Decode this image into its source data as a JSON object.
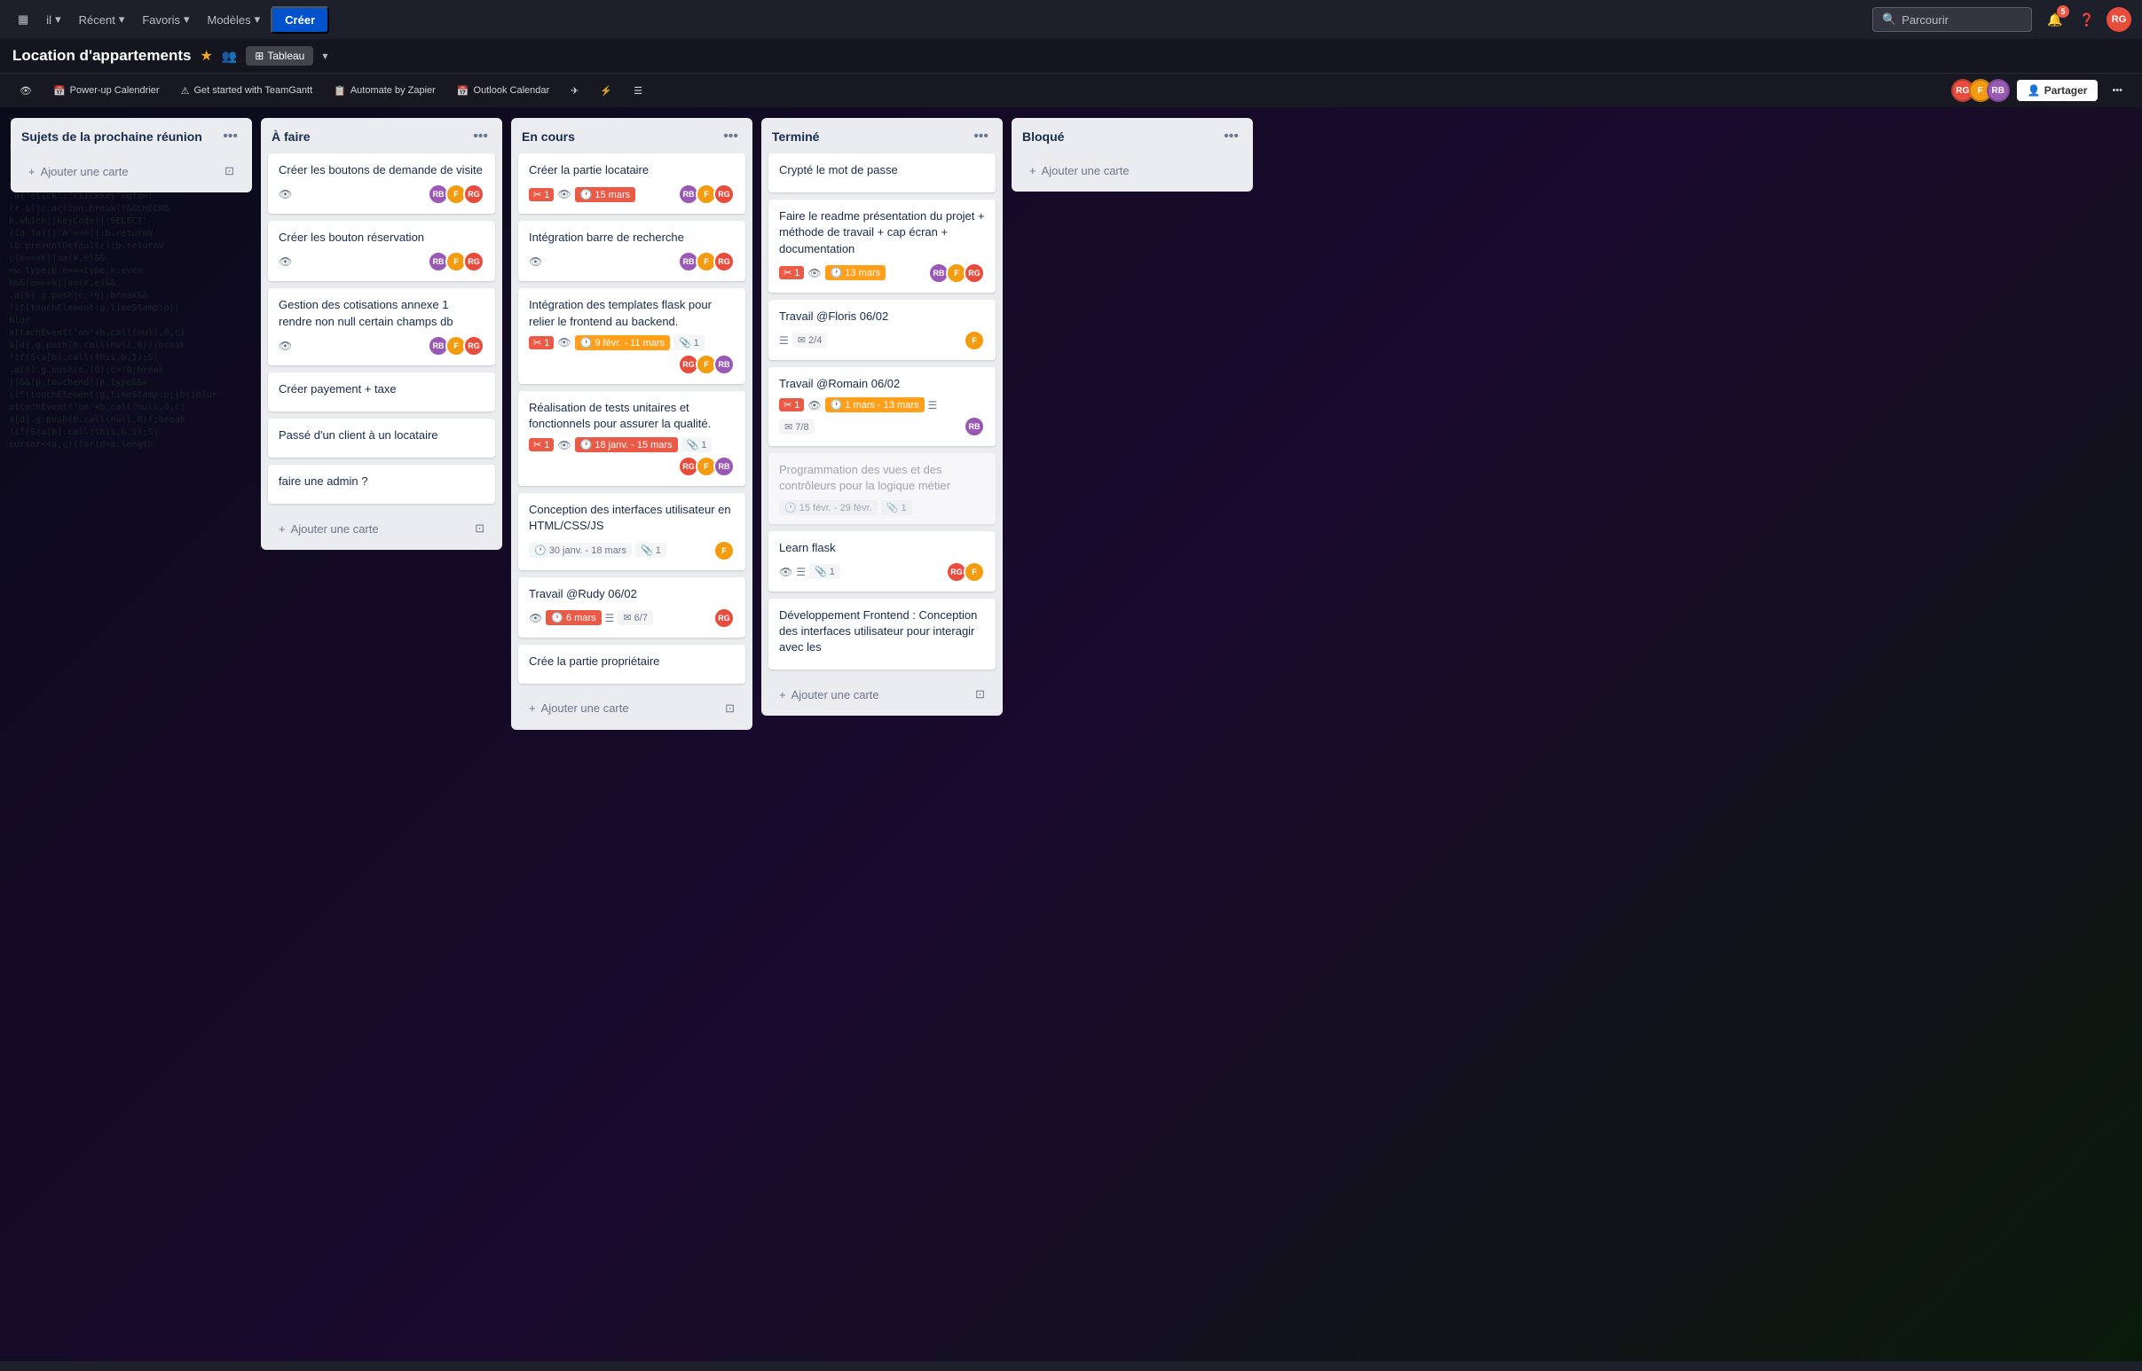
{
  "nav": {
    "items": [
      "il",
      "Récent",
      "Favoris",
      "Modèles"
    ],
    "create_label": "Créer",
    "search_placeholder": "Parcourir",
    "notification_count": "5"
  },
  "board": {
    "title": "Location d'appartements",
    "view": "Tableau",
    "share_label": "Partager",
    "toolbar_items": [
      {
        "label": "Power-up Calendrier",
        "icon": "📅"
      },
      {
        "label": "Get started with TeamGantt",
        "icon": "⚠"
      },
      {
        "label": "Automate by Zapier",
        "icon": "📋"
      },
      {
        "label": "Outlook Calendar",
        "icon": "📅"
      }
    ]
  },
  "columns": [
    {
      "id": "sujets",
      "title": "Sujets de la prochaine réunion",
      "cards": [],
      "add_label": "Ajouter une carte"
    },
    {
      "id": "a_faire",
      "title": "À faire",
      "cards": [
        {
          "title": "Créer les boutons de demande de visite",
          "avatars": [
            "RB",
            "F",
            "RG"
          ],
          "avatar_colors": [
            "#9b59b6",
            "#f39c12",
            "#e74c3c"
          ]
        },
        {
          "title": "Créer les bouton réservation",
          "avatars": [
            "RB",
            "F",
            "RG"
          ],
          "avatar_colors": [
            "#9b59b6",
            "#f39c12",
            "#e74c3c"
          ]
        },
        {
          "title": "Gestion des cotisations annexe 1 rendre non null certain champs db",
          "avatars": [
            "RB",
            "F",
            "RG"
          ],
          "avatar_colors": [
            "#9b59b6",
            "#f39c12",
            "#e74c3c"
          ]
        },
        {
          "title": "Créer payement + taxe",
          "avatars": [],
          "avatar_colors": []
        },
        {
          "title": "Passé d'un client à un locataire",
          "avatars": [],
          "avatar_colors": []
        },
        {
          "title": "faire une admin ?",
          "avatars": [],
          "avatar_colors": []
        }
      ],
      "add_label": "Ajouter une carte"
    },
    {
      "id": "en_cours",
      "title": "En cours",
      "cards": [
        {
          "title": "Créer la partie locataire",
          "alert": "1",
          "date": "15 mars",
          "date_color": "red",
          "avatars": [
            "RB",
            "F",
            "RG"
          ],
          "avatar_colors": [
            "#9b59b6",
            "#f39c12",
            "#e74c3c"
          ]
        },
        {
          "title": "Intégration barre de recherche",
          "alert": null,
          "date": null,
          "avatars": [
            "RB",
            "F",
            "RG"
          ],
          "avatar_colors": [
            "#9b59b6",
            "#f39c12",
            "#e74c3c"
          ]
        },
        {
          "title": "Intégration des templates flask pour relier le frontend au backend.",
          "alert": "1",
          "date": "9 févr. - 11 mars",
          "date_color": "orange",
          "attach": "1",
          "avatars": [
            "RG",
            "F",
            "RB"
          ],
          "avatar_colors": [
            "#e74c3c",
            "#f39c12",
            "#9b59b6"
          ]
        },
        {
          "title": "Réalisation de tests unitaires et fonctionnels pour assurer la qualité.",
          "alert": "1",
          "date": "18 janv. - 15 mars",
          "date_color": "red",
          "attach": "1",
          "avatars": [
            "RG",
            "F",
            "RB"
          ],
          "avatar_colors": [
            "#e74c3c",
            "#f39c12",
            "#9b59b6"
          ]
        },
        {
          "title": "Conception des interfaces utilisateur en HTML/CSS/JS",
          "date": "30 janv. - 18 mars",
          "attach": "1",
          "avatars": [
            "F"
          ],
          "avatar_colors": [
            "#f39c12"
          ]
        },
        {
          "title": "Travail @Rudy 06/02",
          "date": "6 mars",
          "date_color": "red",
          "checklist": "6/7",
          "avatars": [
            "RG"
          ],
          "avatar_colors": [
            "#e74c3c"
          ]
        },
        {
          "title": "Crée la partie propriétaire",
          "avatars": [],
          "avatar_colors": []
        }
      ],
      "add_label": "Ajouter une carte"
    },
    {
      "id": "termine",
      "title": "Terminé",
      "cards": [
        {
          "title": "Crypté le mot de passe",
          "avatars": [],
          "avatar_colors": []
        },
        {
          "title": "Faire le readme présentation du projet + méthode de travail + cap écran + documentation",
          "alert": "1",
          "date": "13 mars",
          "date_color": "orange",
          "avatars": [
            "RB",
            "F",
            "RG"
          ],
          "avatar_colors": [
            "#9b59b6",
            "#f39c12",
            "#e74c3c"
          ]
        },
        {
          "title": "Travail @Floris 06/02",
          "checklist": "2/4",
          "avatars": [
            "F"
          ],
          "avatar_colors": [
            "#f39c12"
          ]
        },
        {
          "title": "Travail @Romain 06/02",
          "alert": "1",
          "date": "1 mars - 13 mars",
          "date_color": "orange",
          "checklist2": "7/8",
          "avatars": [
            "RB"
          ],
          "avatar_colors": [
            "#9b59b6"
          ]
        },
        {
          "title": "Programmation des vues et des contrôleurs pour la logique métier",
          "date": "15 févr. - 29 févr.",
          "attach": "1",
          "muted": true,
          "avatars": [],
          "avatar_colors": []
        },
        {
          "title": "Learn flask",
          "attach": "1",
          "avatars": [
            "RG",
            "F"
          ],
          "avatar_colors": [
            "#e74c3c",
            "#f39c12"
          ]
        },
        {
          "title": "Développement Frontend : Conception des interfaces utilisateur pour interagir avec les",
          "avatars": [],
          "avatar_colors": []
        }
      ],
      "add_label": "Ajouter une carte"
    },
    {
      "id": "bloque",
      "title": "Bloqué",
      "cards": [],
      "add_label": "Ajouter une carte"
    }
  ],
  "code_text": "this.q=();this.tagName.to\nribute('type')||e.tagName.to\nn=(e.getAttribute('role')||\n.srcElement||b.target;!=0(\n!t){var y=t;null;'getAttribute\n=w.indexOf(';'):-1!=0,ka=R?\n.a('click':'clickkey'=q?q=:\n(r.s||r.action;break()&&CHECKB\nb.which||keyCode||'SELECT'\n(in fa)||'A'==n||:b.returnV\ntb.preventDefault();b.returnV\nc(e===k||aa(k,e)&&\n=w.type;b.e===type,k.even\nb&&(e===k||aa(k,e)&&\n.a[b].g.push(c,!0);break&&\n!if(touchElement:g,timeStamp:p||\nblur\nattachEvent('on'+b,call(null,0,c)\na[d].g.push(b.call(null,0));break\n!if(S(a[b].call(this,b,1);S(\n.a[d].g.push(c,!0);c=!0;break\n||&&(p.touchend||p.type&&=\n(if(touchElement:g,timeStamp:p||b||blur\nattachEvent('on'+b,call(null,0,c)\na[d].g.push(b.call(null,0));break\n!if(S(a[b].call(this,b,1);S(\ncursor<<a,c){for(d=a.length"
}
